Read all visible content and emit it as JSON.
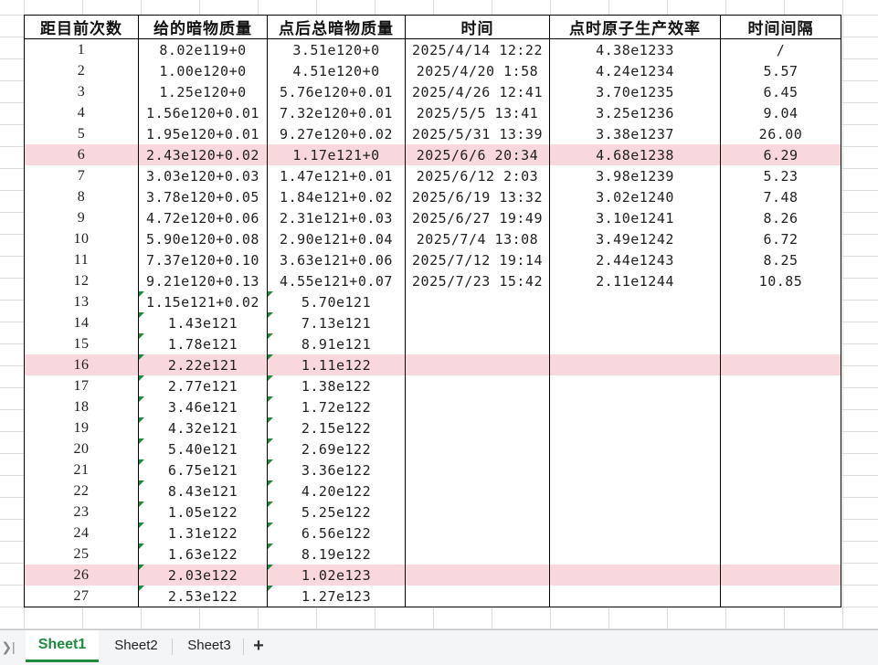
{
  "table": {
    "headers": [
      "距目前次数",
      "给的暗物质量",
      "点后总暗物质量",
      "时间",
      "点时原子生产效率",
      "时间间隔"
    ],
    "highlight_color": "#f8d7dd",
    "error_indicator_color": "#1e8a3e",
    "rows": [
      {
        "cells": [
          "1",
          "8.02e119+0",
          "3.51e120+0",
          "2025/4/14 12:22",
          "4.38e1233",
          "/"
        ],
        "highlight": false,
        "error_flags": [
          false,
          false
        ]
      },
      {
        "cells": [
          "2",
          "1.00e120+0",
          "4.51e120+0",
          "2025/4/20 1:58",
          "4.24e1234",
          "5.57"
        ],
        "highlight": false,
        "error_flags": [
          false,
          false
        ]
      },
      {
        "cells": [
          "3",
          "1.25e120+0",
          "5.76e120+0.01",
          "2025/4/26 12:41",
          "3.70e1235",
          "6.45"
        ],
        "highlight": false,
        "error_flags": [
          false,
          false
        ]
      },
      {
        "cells": [
          "4",
          "1.56e120+0.01",
          "7.32e120+0.01",
          "2025/5/5 13:41",
          "3.25e1236",
          "9.04"
        ],
        "highlight": false,
        "error_flags": [
          false,
          false
        ]
      },
      {
        "cells": [
          "5",
          "1.95e120+0.01",
          "9.27e120+0.02",
          "2025/5/31 13:39",
          "3.38e1237",
          "26.00"
        ],
        "highlight": false,
        "error_flags": [
          false,
          false
        ]
      },
      {
        "cells": [
          "6",
          "2.43e120+0.02",
          "1.17e121+0",
          "2025/6/6 20:34",
          "4.68e1238",
          "6.29"
        ],
        "highlight": true,
        "error_flags": [
          false,
          false
        ]
      },
      {
        "cells": [
          "7",
          "3.03e120+0.03",
          "1.47e121+0.01",
          "2025/6/12 2:03",
          "3.98e1239",
          "5.23"
        ],
        "highlight": false,
        "error_flags": [
          false,
          false
        ]
      },
      {
        "cells": [
          "8",
          "3.78e120+0.05",
          "1.84e121+0.02",
          "2025/6/19 13:32",
          "3.02e1240",
          "7.48"
        ],
        "highlight": false,
        "error_flags": [
          false,
          false
        ]
      },
      {
        "cells": [
          "9",
          "4.72e120+0.06",
          "2.31e121+0.03",
          "2025/6/27 19:49",
          "3.10e1241",
          "8.26"
        ],
        "highlight": false,
        "error_flags": [
          false,
          false
        ]
      },
      {
        "cells": [
          "10",
          "5.90e120+0.08",
          "2.90e121+0.04",
          "2025/7/4 13:08",
          "3.49e1242",
          "6.72"
        ],
        "highlight": false,
        "error_flags": [
          false,
          false
        ]
      },
      {
        "cells": [
          "11",
          "7.37e120+0.10",
          "3.63e121+0.06",
          "2025/7/12 19:14",
          "2.44e1243",
          "8.25"
        ],
        "highlight": false,
        "error_flags": [
          false,
          false
        ]
      },
      {
        "cells": [
          "12",
          "9.21e120+0.13",
          "4.55e121+0.07",
          "2025/7/23 15:42",
          "2.11e1244",
          "10.85"
        ],
        "highlight": false,
        "error_flags": [
          false,
          false
        ]
      },
      {
        "cells": [
          "13",
          "1.15e121+0.02",
          "5.70e121",
          "",
          "",
          ""
        ],
        "highlight": false,
        "error_flags": [
          true,
          true
        ]
      },
      {
        "cells": [
          "14",
          "1.43e121",
          "7.13e121",
          "",
          "",
          ""
        ],
        "highlight": false,
        "error_flags": [
          true,
          true
        ]
      },
      {
        "cells": [
          "15",
          "1.78e121",
          "8.91e121",
          "",
          "",
          ""
        ],
        "highlight": false,
        "error_flags": [
          true,
          true
        ]
      },
      {
        "cells": [
          "16",
          "2.22e121",
          "1.11e122",
          "",
          "",
          ""
        ],
        "highlight": true,
        "error_flags": [
          true,
          true
        ]
      },
      {
        "cells": [
          "17",
          "2.77e121",
          "1.38e122",
          "",
          "",
          ""
        ],
        "highlight": false,
        "error_flags": [
          true,
          true
        ]
      },
      {
        "cells": [
          "18",
          "3.46e121",
          "1.72e122",
          "",
          "",
          ""
        ],
        "highlight": false,
        "error_flags": [
          true,
          true
        ]
      },
      {
        "cells": [
          "19",
          "4.32e121",
          "2.15e122",
          "",
          "",
          ""
        ],
        "highlight": false,
        "error_flags": [
          true,
          true
        ]
      },
      {
        "cells": [
          "20",
          "5.40e121",
          "2.69e122",
          "",
          "",
          ""
        ],
        "highlight": false,
        "error_flags": [
          true,
          true
        ]
      },
      {
        "cells": [
          "21",
          "6.75e121",
          "3.36e122",
          "",
          "",
          ""
        ],
        "highlight": false,
        "error_flags": [
          true,
          true
        ]
      },
      {
        "cells": [
          "22",
          "8.43e121",
          "4.20e122",
          "",
          "",
          ""
        ],
        "highlight": false,
        "error_flags": [
          true,
          true
        ]
      },
      {
        "cells": [
          "23",
          "1.05e122",
          "5.25e122",
          "",
          "",
          ""
        ],
        "highlight": false,
        "error_flags": [
          true,
          true
        ]
      },
      {
        "cells": [
          "24",
          "1.31e122",
          "6.56e122",
          "",
          "",
          ""
        ],
        "highlight": false,
        "error_flags": [
          true,
          true
        ]
      },
      {
        "cells": [
          "25",
          "1.63e122",
          "8.19e122",
          "",
          "",
          ""
        ],
        "highlight": false,
        "error_flags": [
          true,
          true
        ]
      },
      {
        "cells": [
          "26",
          "2.03e122",
          "1.02e123",
          "",
          "",
          ""
        ],
        "highlight": true,
        "error_flags": [
          true,
          true
        ]
      },
      {
        "cells": [
          "27",
          "2.53e122",
          "1.27e123",
          "",
          "",
          ""
        ],
        "highlight": false,
        "error_flags": [
          true,
          true
        ]
      }
    ]
  },
  "sheet_tabs": {
    "nav_icon": "tab-scroll-icon",
    "tabs": [
      {
        "label": "Sheet1",
        "active": true
      },
      {
        "label": "Sheet2",
        "active": false
      },
      {
        "label": "Sheet3",
        "active": false
      }
    ],
    "add_icon": "plus-icon",
    "accent_color": "#1e8a3e"
  }
}
